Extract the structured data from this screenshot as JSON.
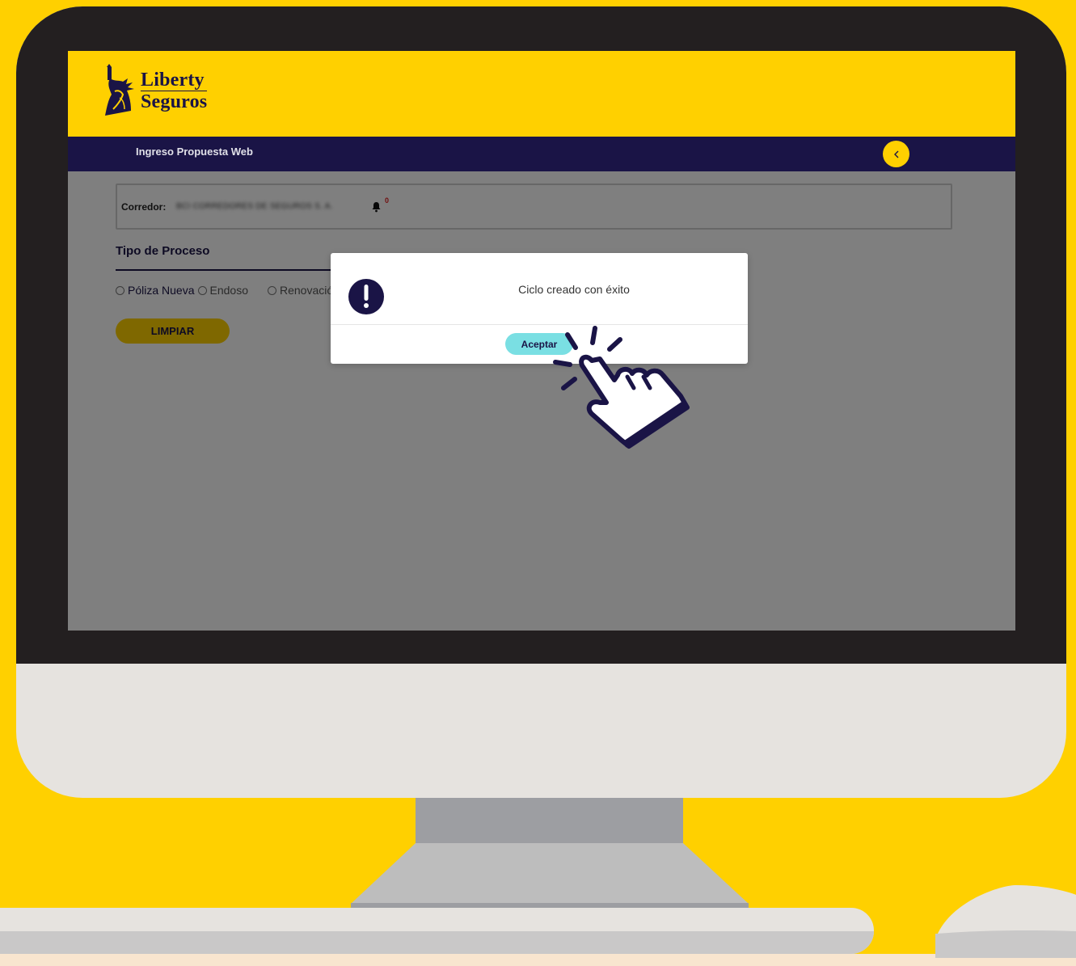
{
  "app": {
    "brand_line1": "Liberty",
    "brand_line2": "Seguros"
  },
  "navbar": {
    "title": "Ingreso Propuesta Web",
    "back_icon": "chevron-left-icon"
  },
  "corredor": {
    "label": "Corredor:",
    "value": "BCI CORREDORES DE SEGUROS S. A.",
    "notifications_count": "0"
  },
  "proceso": {
    "title": "Tipo de Proceso",
    "options": [
      {
        "label": "Póliza Nueva"
      },
      {
        "label": "Endoso"
      },
      {
        "label": "Renovació"
      }
    ],
    "clear_button": "LIMPIAR"
  },
  "modal": {
    "icon": "exclamation-icon",
    "message": "Ciclo creado con éxito",
    "accept_button": "Aceptar"
  },
  "colors": {
    "brand_yellow": "#FFD000",
    "brand_navy": "#1A1446",
    "accent_teal": "#7ADFE3",
    "notification_red": "#E02020"
  }
}
